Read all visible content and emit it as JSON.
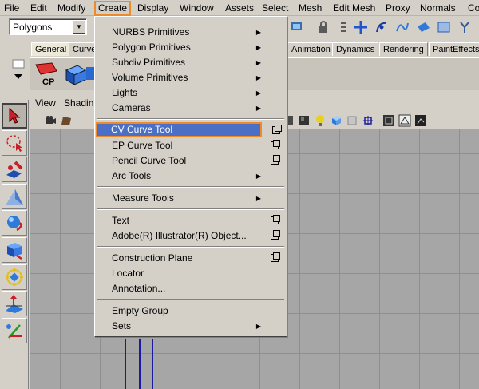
{
  "menubar": {
    "items": [
      "File",
      "Edit",
      "Modify",
      "Create",
      "Display",
      "Window",
      "Assets",
      "Select",
      "Mesh",
      "Edit Mesh",
      "Proxy",
      "Normals",
      "Co"
    ],
    "active": "Create"
  },
  "statusline": {
    "mode_value": "Polygons",
    "mode_arrow": "▼"
  },
  "shelf": {
    "tabs": [
      "General",
      "Curve",
      "Animation",
      "Dynamics",
      "Rendering",
      "PaintEffects"
    ],
    "cp_label": "CP"
  },
  "panel": {
    "menu": [
      "View",
      "Shadin"
    ]
  },
  "dropdown": {
    "items": [
      {
        "label": "NURBS Primitives",
        "submenu": true
      },
      {
        "label": "Polygon Primitives",
        "submenu": true
      },
      {
        "label": "Subdiv Primitives",
        "submenu": true
      },
      {
        "label": "Volume Primitives",
        "submenu": true
      },
      {
        "label": "Lights",
        "submenu": true
      },
      {
        "label": "Cameras",
        "submenu": true
      },
      {
        "label": "CV Curve Tool",
        "option": true,
        "highlighted": true
      },
      {
        "label": "EP Curve Tool",
        "option": true
      },
      {
        "label": "Pencil Curve Tool",
        "option": true
      },
      {
        "label": "Arc Tools",
        "submenu": true
      },
      {
        "label": "Measure Tools",
        "submenu": true
      },
      {
        "label": "Text",
        "option": true
      },
      {
        "label": "Adobe(R) Illustrator(R) Object...",
        "option": true
      },
      {
        "label": "Construction Plane",
        "option": true
      },
      {
        "label": "Locator"
      },
      {
        "label": "Annotation..."
      },
      {
        "label": "Empty Group"
      },
      {
        "label": "Sets",
        "submenu": true
      }
    ],
    "submenu_glyph": "▶"
  },
  "colors": {
    "highlight_border": "#ee8a2a",
    "highlight_fill": "#4a6fc4",
    "ui_gray": "#d4d0c8",
    "viewport_gray": "#a6a6a6"
  }
}
